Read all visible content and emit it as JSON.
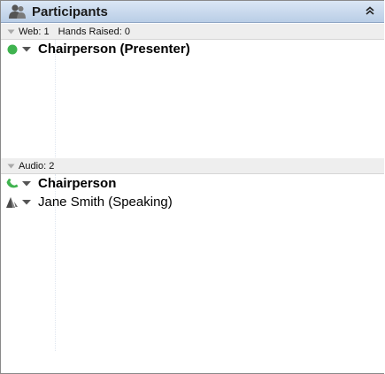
{
  "panel": {
    "title": "Participants",
    "collapse_icon": "double-chevron-up-icon"
  },
  "web_section": {
    "web_label": "Web: 1",
    "hands_label": "Hands Raised: 0",
    "participants": [
      {
        "name": "Chairperson (Presenter)",
        "status_icon": "green-dot-icon",
        "bold": true
      }
    ]
  },
  "audio_section": {
    "label": "Audio: 2",
    "participants": [
      {
        "name": "Chairperson",
        "status_icon": "phone-icon",
        "bold": true
      },
      {
        "name": "Jane Smith (Speaking)",
        "status_icon": "speaking-icon",
        "bold": false
      }
    ]
  },
  "colors": {
    "titlebar_top": "#dbe7f5",
    "titlebar_bottom": "#b9cde6",
    "status_green": "#3fb34f",
    "section_bg": "#eeeeee"
  }
}
